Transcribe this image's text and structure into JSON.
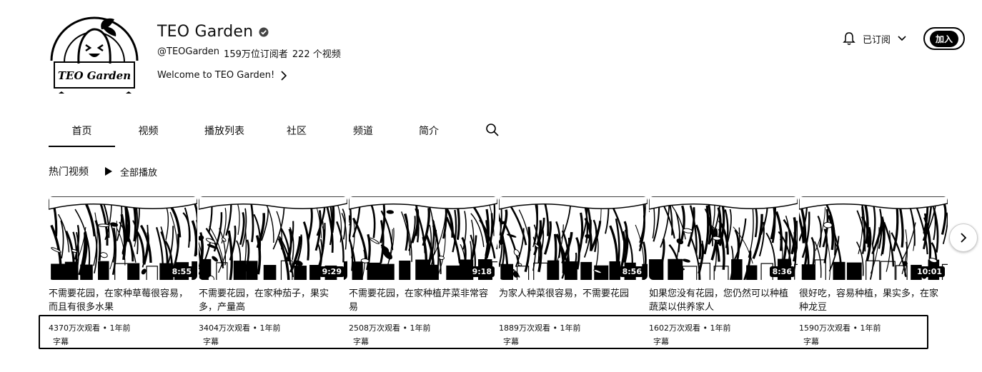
{
  "channel": {
    "name": "TEO Garden",
    "handle": "@TEOGarden",
    "subscribers": "159万位订阅者",
    "video_count": "222 个视频",
    "description": "Welcome to TEO Garden!",
    "avatar_text": "TEO Garden"
  },
  "actions": {
    "subscribed_label": "已订阅",
    "join_label": "加入"
  },
  "tabs": [
    {
      "label": "首页",
      "active": true
    },
    {
      "label": "视频"
    },
    {
      "label": "播放列表"
    },
    {
      "label": "社区"
    },
    {
      "label": "频道"
    },
    {
      "label": "简介"
    }
  ],
  "section": {
    "title": "热门视频",
    "play_all": "全部播放"
  },
  "videos": [
    {
      "title": "不需要花园，在家种草莓很容易，而且有很多水果",
      "duration": "8:55",
      "views": "4370万次观看",
      "age": "1年前",
      "badge": "字幕"
    },
    {
      "title": "不需要花园，在家种茄子，果实多，产量高",
      "duration": "9:29",
      "views": "3404万次观看",
      "age": "1年前",
      "badge": "字幕"
    },
    {
      "title": "不需要花园，在家种植芹菜非常容易",
      "duration": "9:18",
      "views": "2508万次观看",
      "age": "1年前",
      "badge": "字幕"
    },
    {
      "title": "为家人种菜很容易，不需要花园",
      "duration": "8:56",
      "views": "1889万次观看",
      "age": "1年前",
      "badge": "字幕"
    },
    {
      "title": "如果您没有花园，您仍然可以种植蔬菜以供养家人",
      "duration": "8:36",
      "views": "1602万次观看",
      "age": "1年前",
      "badge": "字幕"
    },
    {
      "title": "很好吃，容易种植，果实多，在家种龙豆",
      "duration": "10:01",
      "views": "1590万次观看",
      "age": "1年前",
      "badge": "字幕"
    }
  ]
}
